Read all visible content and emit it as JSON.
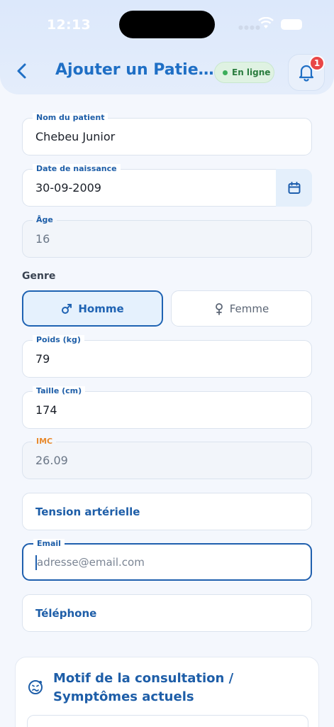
{
  "status_bar": {
    "time": "12:13"
  },
  "header": {
    "title": "Ajouter un Patie…",
    "status": "En ligne",
    "notifications_count": "1",
    "colors": {
      "accent": "#1f6fc5",
      "online": "#3cae5a",
      "badge": "#e94747"
    }
  },
  "form": {
    "patient_name": {
      "label": "Nom du patient",
      "value": "Chebeu Junior"
    },
    "birth_date": {
      "label": "Date de naissance",
      "value": "30-09-2009"
    },
    "age": {
      "label": "Âge",
      "value": "16"
    },
    "gender": {
      "label": "Genre",
      "male": "Homme",
      "female": "Femme",
      "selected": "Homme"
    },
    "weight": {
      "label": "Poids (kg)",
      "value": "79"
    },
    "height": {
      "label": "Taille (cm)",
      "value": "174"
    },
    "bmi": {
      "label": "IMC",
      "value": "26.09"
    },
    "blood_pressure": {
      "label": "Tension artérielle"
    },
    "email": {
      "label": "Email",
      "placeholder": "adresse@email.com"
    },
    "phone": {
      "label": "Téléphone"
    }
  },
  "consultation": {
    "title": "Motif de la consultation / Symptômes actuels"
  }
}
